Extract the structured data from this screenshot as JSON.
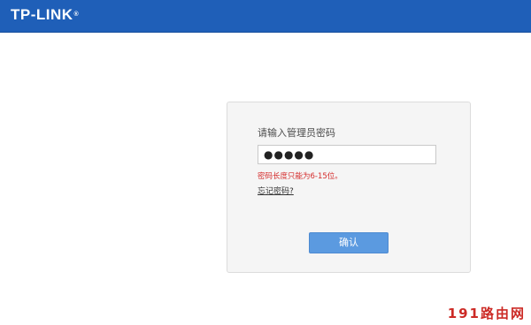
{
  "header": {
    "brand": "TP-LINK",
    "brand_mark": "®",
    "bg_color": "#1f5fb8"
  },
  "login": {
    "prompt": "请输入管理员密码",
    "password_value": "●●●●●",
    "error": "密码长度只能为6-15位。",
    "forgot_link": "忘记密码?",
    "confirm_button": "确认",
    "button_color": "#5b9ae0",
    "error_color": "#d42a2a"
  },
  "watermark": {
    "text": "191路由网",
    "color": "#cc2a25"
  }
}
